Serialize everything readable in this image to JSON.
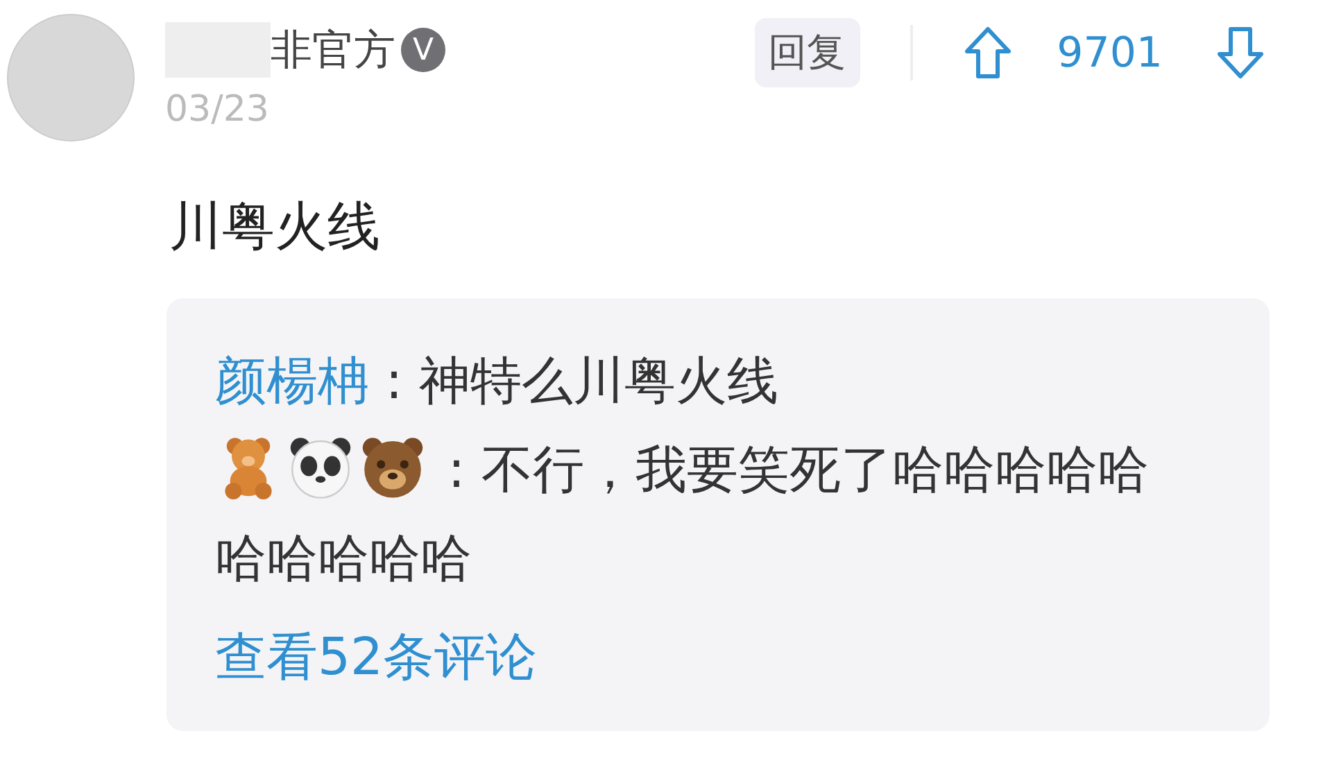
{
  "comment": {
    "author": "非官方",
    "badge": "V",
    "date": "03/23",
    "reply_button": "回复",
    "votes": "9701",
    "text": "川粤火线",
    "replies": [
      {
        "kind": "named",
        "author": "颜楊柟",
        "separator": ":",
        "text": "神特么川粤火线"
      },
      {
        "kind": "emoji",
        "separator": ":",
        "text_lines": [
          "不行，我要笑死了哈哈哈哈哈",
          "哈哈哈哈哈"
        ]
      }
    ],
    "more_link": "查看52条评论"
  }
}
